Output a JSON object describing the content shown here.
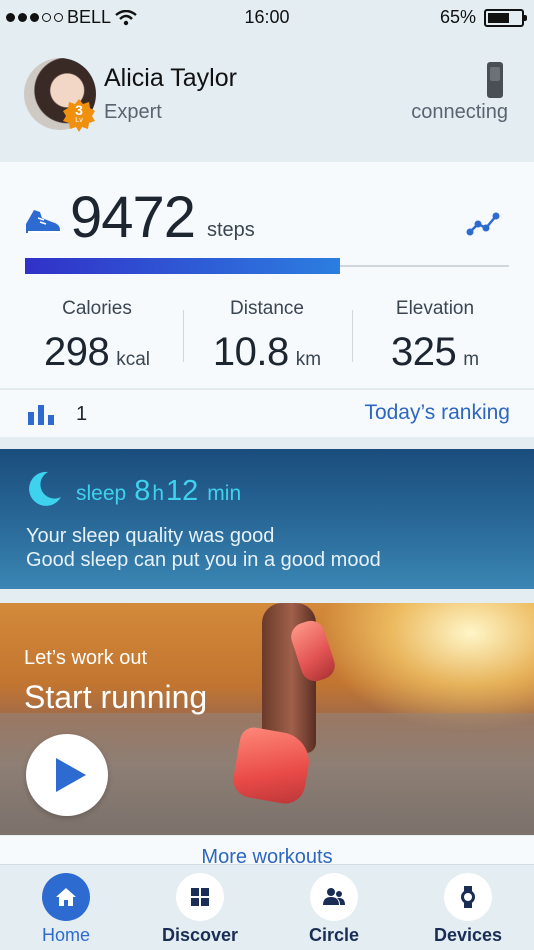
{
  "status_bar": {
    "carrier": "BELL",
    "signal_bars_filled": 3,
    "signal_bars_total": 5,
    "time": "16:00",
    "battery_percent": "65%",
    "battery_level": 0.65
  },
  "profile": {
    "name": "Alicia Taylor",
    "rank": "Expert",
    "level": "3",
    "level_label": "Lv",
    "device_status": "connecting"
  },
  "steps": {
    "value": "9472",
    "unit": "steps",
    "progress": 0.65
  },
  "stats": [
    {
      "label": "Calories",
      "value": "298",
      "unit": "kcal"
    },
    {
      "label": "Distance",
      "value": "10.8",
      "unit": "km"
    },
    {
      "label": "Elevation",
      "value": "325",
      "unit": "m"
    }
  ],
  "ranking": {
    "position": "1",
    "link_label": "Today’s ranking"
  },
  "sleep": {
    "label": "sleep",
    "hours": "8",
    "hours_unit": "h",
    "minutes": "12",
    "minutes_unit": "min",
    "line1": "Your sleep quality was good",
    "line2": "Good sleep can put you in a good mood"
  },
  "workout": {
    "subtitle": "Let’s work out",
    "title": "Start running",
    "more_label": "More workouts"
  },
  "tabs": [
    {
      "label": "Home",
      "icon": "home-icon",
      "active": true
    },
    {
      "label": "Discover",
      "icon": "grid-icon",
      "active": false
    },
    {
      "label": "Circle",
      "icon": "people-icon",
      "active": false
    },
    {
      "label": "Devices",
      "icon": "watch-icon",
      "active": false
    }
  ],
  "colors": {
    "accent": "#2d6bd0",
    "sleep_text": "#3fd2ee",
    "progress_start": "#3131c8",
    "progress_end": "#2c7ee0"
  }
}
